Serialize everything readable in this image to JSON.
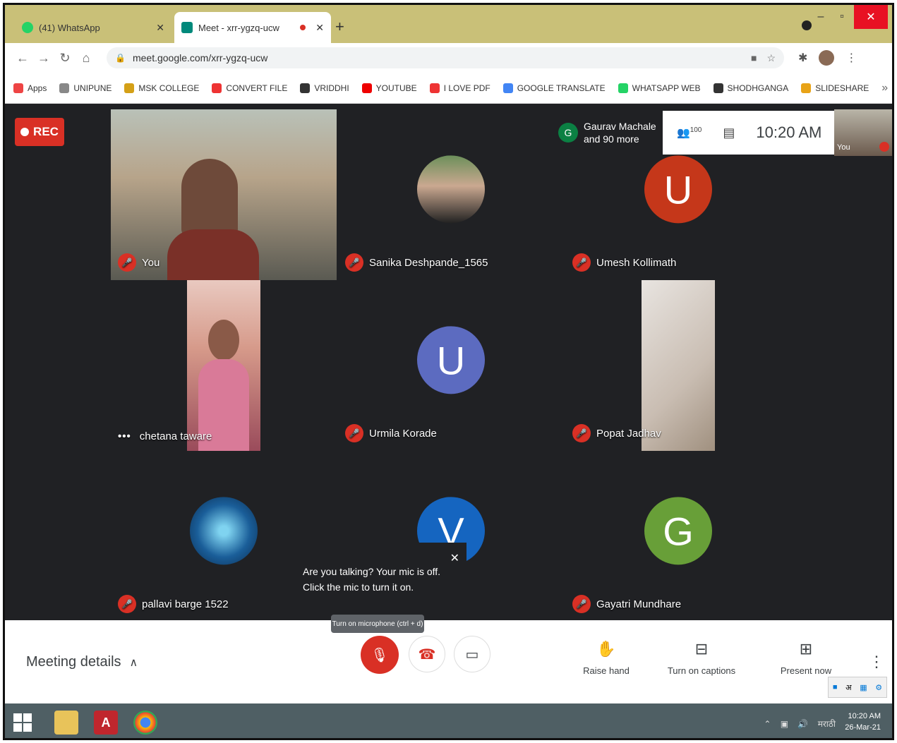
{
  "browser": {
    "tabs": [
      {
        "title": "(41) WhatsApp",
        "active": false
      },
      {
        "title": "Meet - xrr-ygzq-ucw",
        "active": true
      }
    ],
    "new_tab": "+",
    "url": "meet.google.com/xrr-ygzq-ucw",
    "bookmarks": [
      {
        "label": "Apps",
        "color": "#e44"
      },
      {
        "label": "UNIPUNE",
        "color": "#888"
      },
      {
        "label": "MSK COLLEGE",
        "color": "#d4a017"
      },
      {
        "label": "CONVERT FILE",
        "color": "#e33"
      },
      {
        "label": "VRIDDHI",
        "color": "#333"
      },
      {
        "label": "YOUTUBE",
        "color": "#e00"
      },
      {
        "label": "I LOVE PDF",
        "color": "#e33"
      },
      {
        "label": "GOOGLE TRANSLATE",
        "color": "#4285f4"
      },
      {
        "label": "WHATSAPP WEB",
        "color": "#25d366"
      },
      {
        "label": "SHODHGANGA",
        "color": "#333"
      },
      {
        "label": "SLIDESHARE",
        "color": "#e8a317"
      }
    ]
  },
  "meet": {
    "rec_label": "REC",
    "participants_summary": {
      "avatar_letter": "G",
      "line1": "Gaurav Machale",
      "line2": "and 90 more",
      "count": "100"
    },
    "time": "10:20 AM",
    "self_thumb_label": "You",
    "tiles": [
      {
        "name": "You",
        "kind": "camera",
        "muted": true
      },
      {
        "name": "Sanika Deshpande_1565",
        "kind": "photo",
        "muted": true
      },
      {
        "name": "Umesh Kollimath",
        "kind": "letter",
        "letter": "U",
        "color": "#c5371a",
        "muted": true
      },
      {
        "name": "chetana taware",
        "kind": "camera",
        "muted": false
      },
      {
        "name": "Urmila Korade",
        "kind": "letter",
        "letter": "U",
        "color": "#5c6bc0",
        "muted": true
      },
      {
        "name": "Popat Jadhav",
        "kind": "camera",
        "muted": true
      },
      {
        "name": "pallavi barge 1522",
        "kind": "photo",
        "muted": true
      },
      {
        "name": "",
        "kind": "letter",
        "letter": "V",
        "color": "#1565c0",
        "muted": true
      },
      {
        "name": "Gayatri Mundhare",
        "kind": "letter",
        "letter": "G",
        "color": "#689f38",
        "muted": true
      }
    ],
    "toast": "Are you talking? Your mic is off. Click the mic to turn it on.",
    "tooltip": "Turn on microphone (ctrl + d)"
  },
  "bottom_bar": {
    "meeting_details": "Meeting details",
    "raise_hand": "Raise hand",
    "captions": "Turn on captions",
    "present": "Present now"
  },
  "taskbar": {
    "time": "10:20 AM",
    "date": "26-Mar-21",
    "lang": "मराठी"
  }
}
